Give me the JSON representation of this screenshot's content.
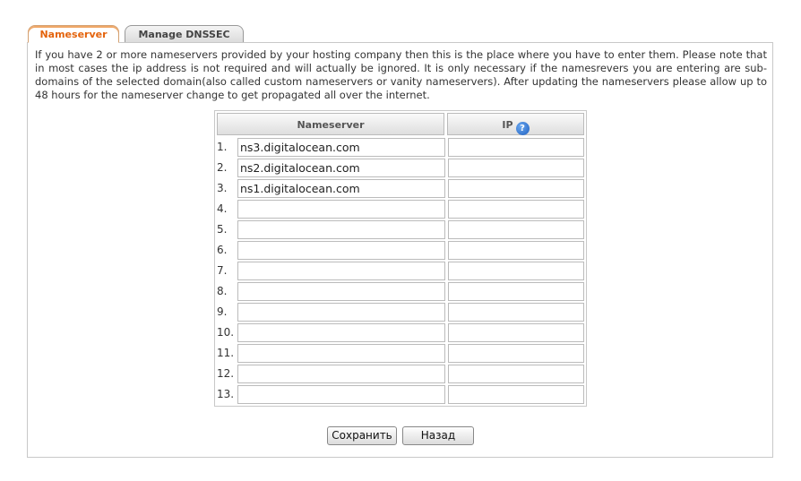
{
  "tabs": {
    "nameserver": "Nameserver",
    "dnssec": "Manage DNSSEC"
  },
  "intro_text": "If you have 2 or more nameservers provided by your hosting company then this is the place where you have to enter them. Please note that in most cases the ip address is not required and will actually be ignored. It is only necessary if the namesrevers you are entering are sub-domains of the selected domain(also called custom nameservers or vanity nameservers). After updating the nameservers please allow up to 48 hours for the nameserver change to get propagated all over the internet.",
  "table": {
    "col_nameserver": "Nameserver",
    "col_ip": "IP",
    "help_glyph": "?",
    "rows": [
      {
        "num": "1.",
        "ns": "ns3.digitalocean.com",
        "ip": ""
      },
      {
        "num": "2.",
        "ns": "ns2.digitalocean.com",
        "ip": ""
      },
      {
        "num": "3.",
        "ns": "ns1.digitalocean.com",
        "ip": ""
      },
      {
        "num": "4.",
        "ns": "",
        "ip": ""
      },
      {
        "num": "5.",
        "ns": "",
        "ip": ""
      },
      {
        "num": "6.",
        "ns": "",
        "ip": ""
      },
      {
        "num": "7.",
        "ns": "",
        "ip": ""
      },
      {
        "num": "8.",
        "ns": "",
        "ip": ""
      },
      {
        "num": "9.",
        "ns": "",
        "ip": ""
      },
      {
        "num": "10.",
        "ns": "",
        "ip": ""
      },
      {
        "num": "11.",
        "ns": "",
        "ip": ""
      },
      {
        "num": "12.",
        "ns": "",
        "ip": ""
      },
      {
        "num": "13.",
        "ns": "",
        "ip": ""
      }
    ]
  },
  "buttons": {
    "save": "Сохранить",
    "back": "Назад"
  },
  "colors": {
    "active_tab_text": "#e4630c",
    "help_icon": "#1f5fbf",
    "border": "#c8c8c8"
  },
  "icons": {
    "help": "question-mark-circle-icon"
  }
}
